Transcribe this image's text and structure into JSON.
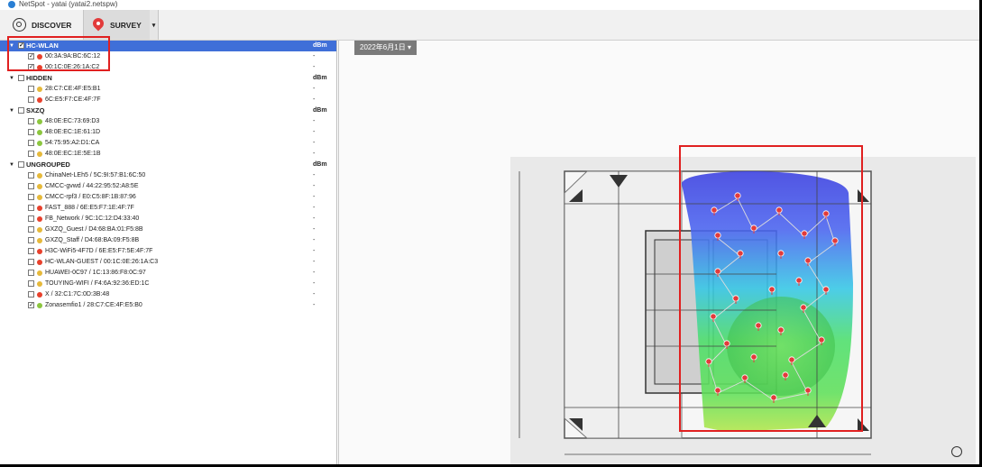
{
  "window": {
    "title": "NetSpot - yatai (yatai2.netspw)"
  },
  "toolbar": {
    "discover_label": "DISCOVER",
    "survey_label": "SURVEY",
    "dropdown_glyph": "▾"
  },
  "tree": {
    "unit_label": "dBm",
    "groups": [
      {
        "name": "HC-WLAN",
        "checked": true,
        "selected": true,
        "items": [
          {
            "label": "00:3A:9A:BC:6C:12",
            "checked": true,
            "signal": "#e8402c",
            "value": "-"
          },
          {
            "label": "00:1C:0E:26:1A:C2",
            "checked": true,
            "signal": "#e8402c",
            "value": "-"
          }
        ]
      },
      {
        "name": "HIDDEN",
        "checked": false,
        "selected": false,
        "items": [
          {
            "label": "28:C7:CE:4F:E5:B1",
            "checked": false,
            "signal": "#e6b93a",
            "value": "-"
          },
          {
            "label": "6C:E5:F7:CE:4F:7F",
            "checked": false,
            "signal": "#e8402c",
            "value": "-"
          }
        ]
      },
      {
        "name": "SXZQ",
        "checked": false,
        "selected": false,
        "items": [
          {
            "label": "48:0E:EC:73:69:D3",
            "checked": false,
            "signal": "#8cc63f",
            "value": "-"
          },
          {
            "label": "48:0E:EC:1E:61:1D",
            "checked": false,
            "signal": "#8cc63f",
            "value": "-"
          },
          {
            "label": "54:75:95:A2:D1:CA",
            "checked": false,
            "signal": "#8cc63f",
            "value": "-"
          },
          {
            "label": "48:0E:EC:1E:5E:1B",
            "checked": false,
            "signal": "#e6b93a",
            "value": "-"
          }
        ]
      },
      {
        "name": "UNGROUPED",
        "checked": false,
        "selected": false,
        "items": [
          {
            "label": "ChinaNet-LEh5 / 5C:9I:57:B1:6C:50",
            "checked": false,
            "signal": "#e6b93a",
            "value": "-"
          },
          {
            "label": "CMCC-gvwd / 44:22:95:52:A8:5E",
            "checked": false,
            "signal": "#e6b93a",
            "value": "-"
          },
          {
            "label": "CMCC-rpf3 / E0:C5:8F:1B:87:96",
            "checked": false,
            "signal": "#e6b93a",
            "value": "-"
          },
          {
            "label": "FAST_888 / 6E:E5:F7:1E:4F:7F",
            "checked": false,
            "signal": "#e8402c",
            "value": "-"
          },
          {
            "label": "FB_Network / 9C:1C:12:D4:33:40",
            "checked": false,
            "signal": "#e8402c",
            "value": "-"
          },
          {
            "label": "GXZQ_Guest / D4:68:BA:01:F5:8B",
            "checked": false,
            "signal": "#e6b93a",
            "value": "-"
          },
          {
            "label": "GXZQ_Staff / D4:68:BA:09:F5:8B",
            "checked": false,
            "signal": "#e6b93a",
            "value": "-"
          },
          {
            "label": "H3C-WiFi5-4F7D / 6E:E5:F7:5E:4F:7F",
            "checked": false,
            "signal": "#e8402c",
            "value": "-"
          },
          {
            "label": "HC-WLAN-GUEST / 00:1C:0E:26:1A:C3",
            "checked": false,
            "signal": "#e8402c",
            "value": "-"
          },
          {
            "label": "HUAWEI-0C97 / 1C:13:86:F8:0C:97",
            "checked": false,
            "signal": "#e6b93a",
            "value": "-"
          },
          {
            "label": "TOUYING-WIFI / F4:6A:92:36:ED:1C",
            "checked": false,
            "signal": "#e6b93a",
            "value": "-"
          },
          {
            "label": "X / 32:C1:7C:0D:3B:48",
            "checked": false,
            "signal": "#e8402c",
            "value": "-"
          },
          {
            "label": "Zonasemfio1 / 28:C7:CE:4F:E5:B0",
            "checked": true,
            "signal": "#8cc63f",
            "value": "-"
          }
        ]
      }
    ]
  },
  "map": {
    "date_label": "2022年6月1日",
    "date_caret": "▾"
  },
  "colors": {
    "selection": "#3f6fd8",
    "highlight": "#e02020",
    "signal_strong": "#8cc63f",
    "signal_medium": "#e6b93a",
    "signal_weak": "#e8402c"
  },
  "icons": [
    "app-icon",
    "discover-gear-icon",
    "survey-pin-icon",
    "dropdown-caret-icon",
    "survey-point-icon",
    "compass-icon"
  ]
}
